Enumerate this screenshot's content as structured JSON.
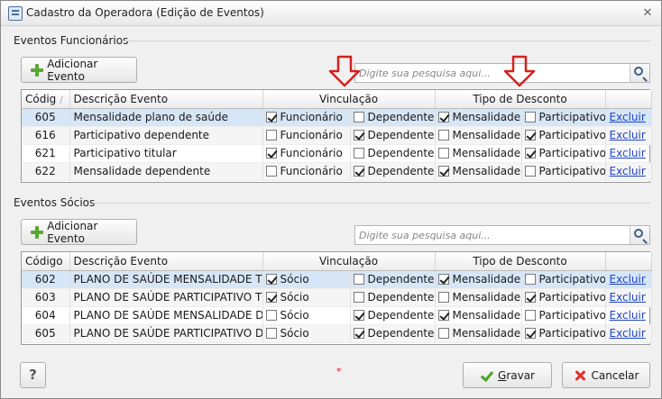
{
  "window": {
    "title": "Cadastro da Operadora (Edição de Eventos)",
    "close_glyph": "✕",
    "icon": "form-icon"
  },
  "funcionarios": {
    "group_title": "Eventos Funcionários",
    "add_label": "Adicionar Evento",
    "search_placeholder": "Digite sua pesquisa aqui...",
    "columns": {
      "codigo": "Códig",
      "descricao": "Descrição Evento",
      "vinculacao": "Vinculação",
      "tipo": "Tipo de Desconto"
    },
    "rows": [
      {
        "code": "605",
        "desc": "Mensalidade plano de saúde",
        "func": true,
        "dep": false,
        "mens": true,
        "part": false,
        "action": "Excluir"
      },
      {
        "code": "616",
        "desc": "Participativo dependente",
        "func": false,
        "dep": true,
        "mens": false,
        "part": true,
        "action": "Excluir"
      },
      {
        "code": "621",
        "desc": "Participativo titular",
        "func": true,
        "dep": false,
        "mens": false,
        "part": true,
        "action": "Excluir"
      },
      {
        "code": "622",
        "desc": "Mensalidade dependente",
        "func": false,
        "dep": true,
        "mens": true,
        "part": false,
        "action": "Excluir"
      }
    ],
    "labels": {
      "func": "Funcionário",
      "dep": "Dependente",
      "mens": "Mensalidade",
      "part": "Participativo"
    }
  },
  "socios": {
    "group_title": "Eventos Sócios",
    "add_label": "Adicionar Evento",
    "search_placeholder": "Digite sua pesquisa aqui...",
    "columns": {
      "codigo": "Código",
      "descricao": "Descrição Evento",
      "vinculacao": "Vinculação",
      "tipo": "Tipo de Desconto"
    },
    "rows": [
      {
        "code": "602",
        "desc": "PLANO DE SAÚDE MENSALIDADE TITULAR",
        "socio": true,
        "dep": false,
        "mens": true,
        "part": false,
        "action": "Excluir"
      },
      {
        "code": "603",
        "desc": "PLANO DE SAÚDE PARTICIPATIVO TITULAR",
        "socio": true,
        "dep": false,
        "mens": false,
        "part": true,
        "action": "Excluir"
      },
      {
        "code": "604",
        "desc": "PLANO DE SAÚDE MENSALIDADE DEPENDENTE",
        "socio": false,
        "dep": true,
        "mens": true,
        "part": false,
        "action": "Excluir"
      },
      {
        "code": "605",
        "desc": "PLANO DE SAÚDE PARTICIPATIVO DEPENDENTE",
        "socio": false,
        "dep": true,
        "mens": false,
        "part": true,
        "action": "Excluir"
      }
    ],
    "labels": {
      "socio": "Sócio",
      "dep": "Dependente",
      "mens": "Mensalidade",
      "part": "Participativo"
    }
  },
  "footer": {
    "help_label": "?",
    "required_mark": "*",
    "save_label": "Gravar",
    "save_accesskey": "G",
    "cancel_label": "Cancelar"
  },
  "colors": {
    "selected_row": "#d6e6f6",
    "link": "#1d43c8",
    "arrow": "#d42020"
  }
}
